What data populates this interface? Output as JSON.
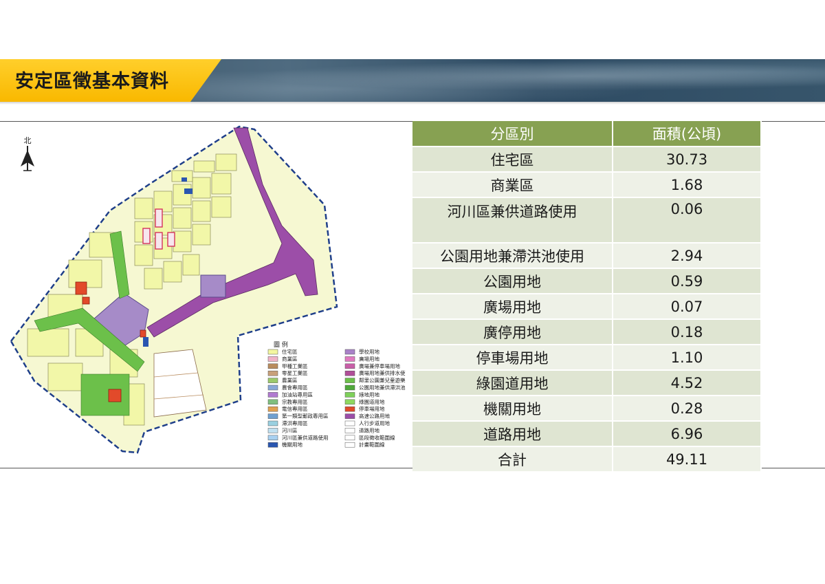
{
  "header": {
    "title": "安定區徵基本資料"
  },
  "map": {
    "north_label": "北",
    "legend_title": "圖 例",
    "legend_left": [
      {
        "label": "住宅區",
        "color": "#f3f6a0"
      },
      {
        "label": "商業區",
        "color": "#f0b3c8"
      },
      {
        "label": "甲種工業區",
        "color": "#b98c5e"
      },
      {
        "label": "零星工業區",
        "color": "#c8a07a"
      },
      {
        "label": "農業區",
        "color": "#9cc96b"
      },
      {
        "label": "農會專用區",
        "color": "#8aa8d8"
      },
      {
        "label": "加油站專用區",
        "color": "#b07ad0"
      },
      {
        "label": "宗教專用區",
        "color": "#7fbf7f"
      },
      {
        "label": "電信專用區",
        "color": "#e0a050"
      },
      {
        "label": "第一類型郵政專用區",
        "color": "#6fa0d0"
      },
      {
        "label": "滯洪專用區",
        "color": "#9ad0e0"
      },
      {
        "label": "河川區",
        "color": "#c0e0f0"
      },
      {
        "label": "河川區兼供道路使用",
        "color": "#a8d0f0"
      },
      {
        "label": "機關用地",
        "color": "#2a56b0"
      }
    ],
    "legend_right": [
      {
        "label": "學校用地",
        "color": "#a982c8"
      },
      {
        "label": "廣場用地",
        "color": "#e07ac0"
      },
      {
        "label": "廣場兼停車場用地",
        "color": "#c95fa8"
      },
      {
        "label": "廣場用地兼供排水使",
        "color": "#b04e98"
      },
      {
        "label": "鄰里公園兼兒童遊樂",
        "color": "#6cc04a"
      },
      {
        "label": "公園用地兼供滯洪池",
        "color": "#4fa83a"
      },
      {
        "label": "綠地用地",
        "color": "#7ed05a"
      },
      {
        "label": "綠園道用地",
        "color": "#8fd860"
      },
      {
        "label": "停車場用地",
        "color": "#e04a2a"
      },
      {
        "label": "高速公路用地",
        "color": "#9c4ea8"
      },
      {
        "label": "人行步道用地",
        "color": "#ffffff"
      },
      {
        "label": "道路用地",
        "color": "#ffffff"
      },
      {
        "label": "區段徵收範圍線",
        "color": "#ffffff"
      },
      {
        "label": "計畫範圍線",
        "color": "#ffffff"
      }
    ]
  },
  "table": {
    "headers": [
      "分區別",
      "面積(公頃)"
    ],
    "rows": [
      {
        "zone": "住宅區",
        "area": "30.73"
      },
      {
        "zone": "商業區",
        "area": "1.68"
      },
      {
        "zone": "河川區兼供道路使用",
        "area": "0.06"
      },
      {
        "zone": "公園用地兼滯洪池使用",
        "area": "2.94"
      },
      {
        "zone": "公園用地",
        "area": "0.59"
      },
      {
        "zone": "廣場用地",
        "area": "0.07"
      },
      {
        "zone": "廣停用地",
        "area": "0.18"
      },
      {
        "zone": "停車場用地",
        "area": "1.10"
      },
      {
        "zone": "綠園道用地",
        "area": "4.52"
      },
      {
        "zone": "機關用地",
        "area": "0.28"
      },
      {
        "zone": "道路用地",
        "area": "6.96"
      },
      {
        "zone": "合計",
        "area": "49.11"
      }
    ]
  }
}
